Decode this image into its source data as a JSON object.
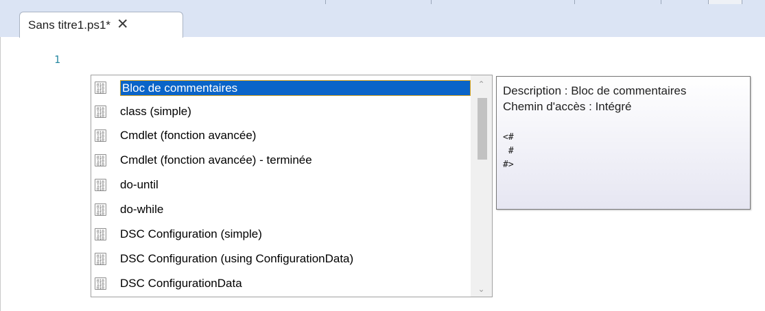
{
  "tab": {
    "title": "Sans titre1.ps1*",
    "close_glyph": "✕",
    "close_icon": "close-icon"
  },
  "editor": {
    "line_numbers": [
      "1"
    ],
    "line_number_color": "#2b8aa3"
  },
  "intellisense": {
    "items": [
      {
        "label": "Bloc de commentaires",
        "icon": "snippet-icon",
        "selected": true
      },
      {
        "label": "class (simple)",
        "icon": "snippet-icon",
        "selected": false
      },
      {
        "label": "Cmdlet (fonction avancée)",
        "icon": "snippet-icon",
        "selected": false
      },
      {
        "label": "Cmdlet (fonction avancée) - terminée",
        "icon": "snippet-icon",
        "selected": false
      },
      {
        "label": "do-until",
        "icon": "snippet-icon",
        "selected": false
      },
      {
        "label": "do-while",
        "icon": "snippet-icon",
        "selected": false
      },
      {
        "label": "DSC Configuration (simple)",
        "icon": "snippet-icon",
        "selected": false
      },
      {
        "label": "DSC Configuration (using ConfigurationData)",
        "icon": "snippet-icon",
        "selected": false
      },
      {
        "label": "DSC ConfigurationData",
        "icon": "snippet-icon",
        "selected": false
      }
    ],
    "selection_color": "#0a64c8",
    "scroll_up_glyph": "⌃",
    "scroll_down_glyph": "⌄"
  },
  "tooltip": {
    "description": "Description : Bloc de commentaires",
    "path": "Chemin d'accès : Intégré",
    "code_lines": [
      "<#",
      " #",
      "#>"
    ]
  }
}
